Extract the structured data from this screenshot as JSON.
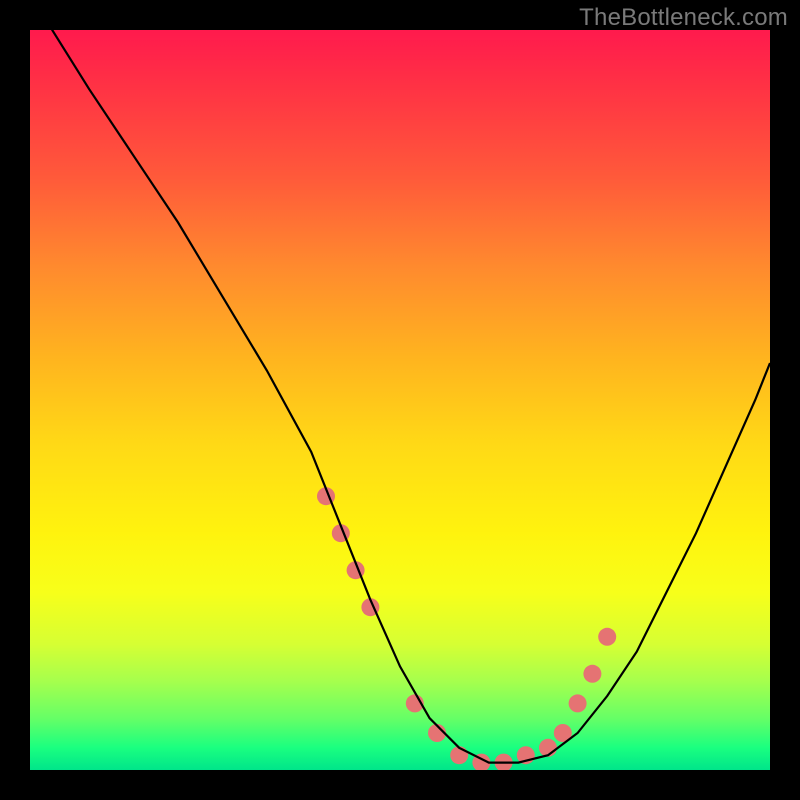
{
  "watermark": "TheBottleneck.com",
  "chart_data": {
    "type": "line",
    "title": "",
    "xlabel": "",
    "ylabel": "",
    "xlim": [
      0,
      100
    ],
    "ylim": [
      0,
      100
    ],
    "series": [
      {
        "name": "bottleneck-curve",
        "x": [
          0,
          3,
          8,
          14,
          20,
          26,
          32,
          38,
          42,
          46,
          50,
          54,
          58,
          62,
          66,
          70,
          74,
          78,
          82,
          86,
          90,
          94,
          98,
          100
        ],
        "values": [
          118,
          100,
          92,
          83,
          74,
          64,
          54,
          43,
          33,
          23,
          14,
          7,
          3,
          1,
          1,
          2,
          5,
          10,
          16,
          24,
          32,
          41,
          50,
          55
        ]
      }
    ],
    "markers": {
      "name": "highlight-dots",
      "x": [
        40,
        42,
        44,
        46,
        52,
        55,
        58,
        61,
        64,
        67,
        70,
        72,
        74,
        76,
        78
      ],
      "values": [
        37,
        32,
        27,
        22,
        9,
        5,
        2,
        1,
        1,
        2,
        3,
        5,
        9,
        13,
        18
      ],
      "color": "#e57373",
      "radius": 9
    },
    "colors": {
      "curve": "#000000",
      "background_top": "#ff1a4d",
      "background_bottom": "#00e58a"
    }
  }
}
